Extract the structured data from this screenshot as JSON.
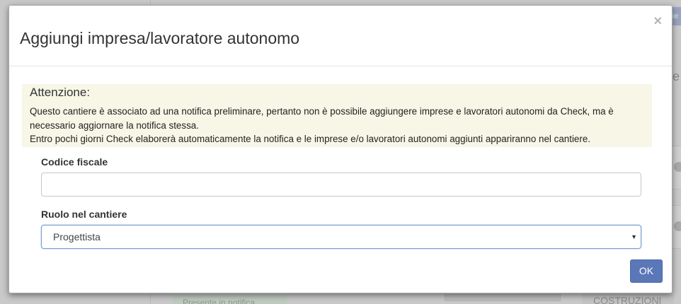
{
  "background": {
    "top_chip": "rie",
    "right_text": "se\nti",
    "bottom_tag": "Presente in notifica",
    "bottom_right": "COSTRUZIONI"
  },
  "modal": {
    "title": "Aggiungi impresa/lavoratore autonomo",
    "close_label": "×",
    "alert": {
      "title": "Attenzione:",
      "line1": "Questo cantiere è associato ad una notifica preliminare, pertanto non è possibile aggiungere imprese e lavoratori autonomi da Check, ma è necessario aggiornare la notifica stessa.",
      "line2": "Entro pochi giorni Check elaborerà automaticamente la notifica e le imprese e/o lavoratori autonomi aggiunti appariranno nel cantiere."
    },
    "codice_fiscale": {
      "label": "Codice fiscale",
      "value": ""
    },
    "ruolo": {
      "label": "Ruolo nel cantiere",
      "selected": "Progettista"
    },
    "ok_label": "OK"
  },
  "colors": {
    "primary_button": "#5a77b8",
    "alert_background": "#f8f6e6"
  }
}
